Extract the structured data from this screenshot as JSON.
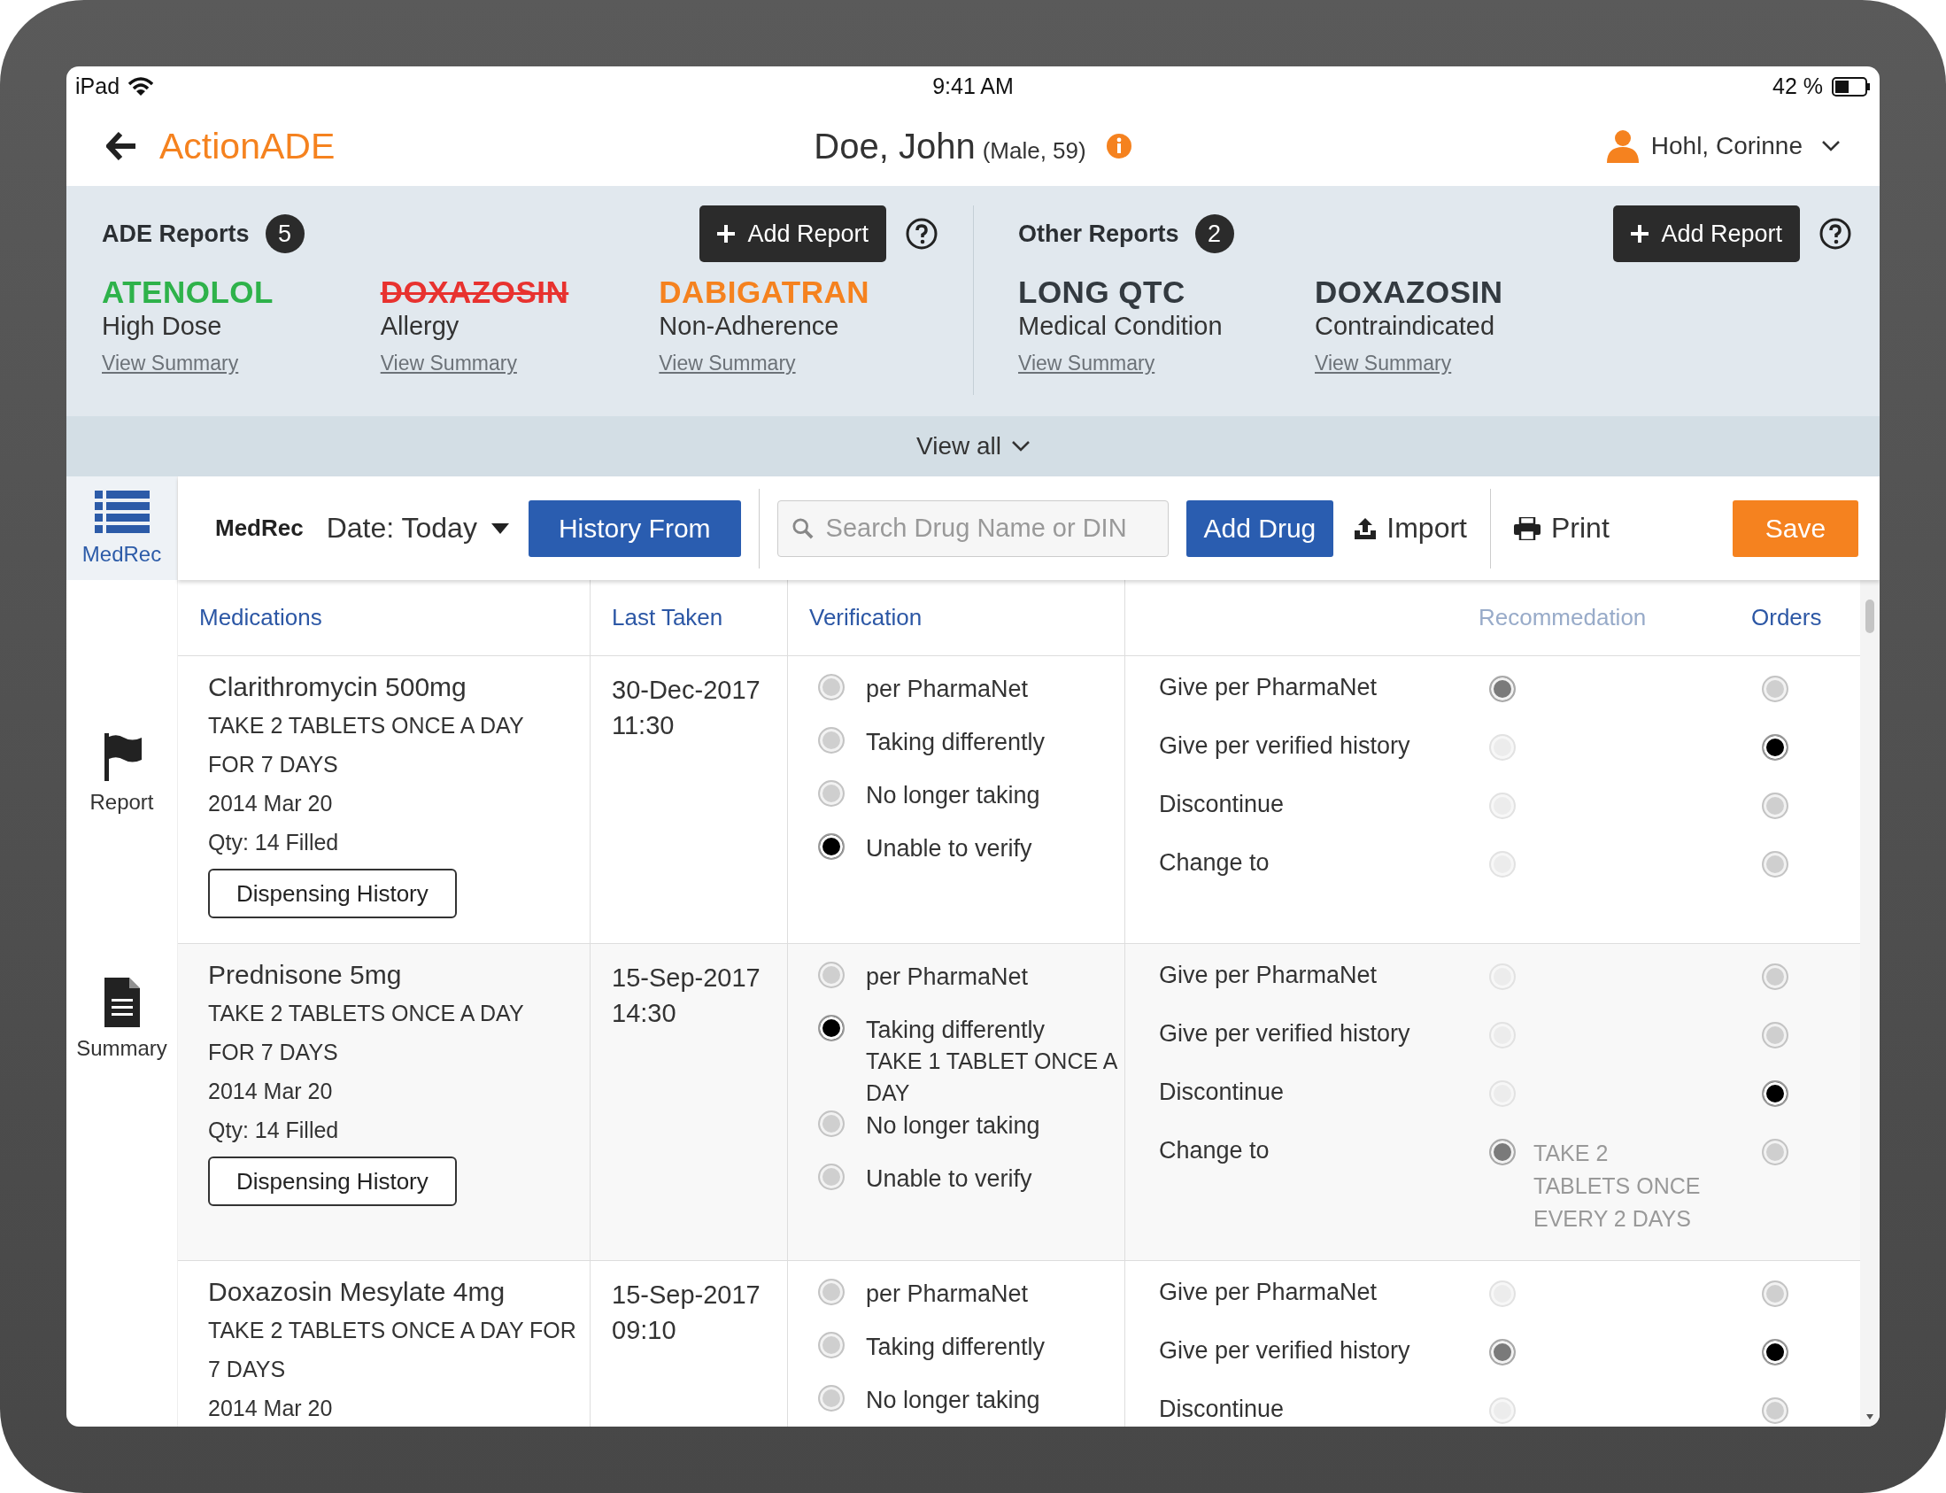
{
  "status_bar": {
    "device": "iPad",
    "time": "9:41 AM",
    "battery": "42 %"
  },
  "header": {
    "app_name": "ActionADE",
    "patient_name": "Doe, John",
    "patient_info": "(Male, 59)",
    "user": "Hohl, Corinne"
  },
  "ade_reports": {
    "title": "ADE Reports",
    "count": "5",
    "add_button": "Add Report",
    "items": [
      {
        "drug": "ATENOLOL",
        "reason": "High Dose",
        "link": "View Summary",
        "color": "#2eb24a",
        "struck": false
      },
      {
        "drug": "DOXAZOSIN",
        "reason": "Allergy",
        "link": "View Summary",
        "color": "#e8322f",
        "struck": true
      },
      {
        "drug": "DABIGATRAN",
        "reason": "Non-Adherence",
        "link": "View Summary",
        "color": "#f5821f",
        "struck": false
      }
    ]
  },
  "other_reports": {
    "title": "Other Reports",
    "count": "2",
    "add_button": "Add Report",
    "items": [
      {
        "drug": "LONG QTC",
        "reason": "Medical Condition",
        "link": "View Summary",
        "color": "#333a40",
        "struck": false
      },
      {
        "drug": "DOXAZOSIN",
        "reason": "Contraindicated",
        "link": "View Summary",
        "color": "#333a40",
        "struck": false
      }
    ]
  },
  "view_all": "View all",
  "sidebar": [
    {
      "label": "MedRec",
      "kind": "list",
      "selected": true
    },
    {
      "label": "Report",
      "kind": "flag",
      "selected": false
    },
    {
      "label": "Summary",
      "kind": "document",
      "selected": false
    }
  ],
  "toolbar": {
    "title": "MedRec",
    "date": "Date: Today",
    "history_button": "History From",
    "search": {
      "placeholder": "Search Drug Name or DIN"
    },
    "add_drug": "Add Drug",
    "import": "Import",
    "print": "Print",
    "save": "Save"
  },
  "table": {
    "columns": [
      {
        "label": "Medications",
        "disabled": false
      },
      {
        "label": "Last Taken",
        "disabled": false
      },
      {
        "label": "Verification",
        "disabled": false
      },
      {
        "label": "Recommedation",
        "disabled": true
      },
      {
        "label": "Orders",
        "disabled": false
      }
    ],
    "rows": [
      {
        "name": "Clarithromycin 500mg",
        "details": [
          "TAKE 2 TABLETS ONCE A DAY",
          "FOR 7 DAYS",
          "2014 Mar 20",
          "Qty: 14 Filled"
        ],
        "history_button": "Dispensing History",
        "last_taken": {
          "date": "30-Dec-2017",
          "time": "11:30"
        },
        "verification": [
          {
            "label": "per PharmaNet",
            "selected": false
          },
          {
            "label": "Taking differently",
            "selected": false
          },
          {
            "label": "No longer taking",
            "selected": false
          },
          {
            "label": "Unable to verify",
            "selected": true
          }
        ],
        "options": [
          {
            "label": "Give per PharmaNet",
            "recommended": true,
            "ordered": false
          },
          {
            "label": "Give per verified history",
            "recommended": false,
            "ordered": true
          },
          {
            "label": "Discontinue",
            "recommended": false,
            "ordered": false
          },
          {
            "label": "Change to",
            "recommended": false,
            "ordered": false
          }
        ]
      },
      {
        "name": "Prednisone 5mg",
        "details": [
          "TAKE 2 TABLETS ONCE A DAY",
          "FOR 7 DAYS",
          "2014 Mar 20",
          "Qty: 14 Filled"
        ],
        "history_button": "Dispensing History",
        "last_taken": {
          "date": "15-Sep-2017",
          "time": "14:30"
        },
        "verification": [
          {
            "label": "per PharmaNet",
            "selected": false
          },
          {
            "label": "Taking differently",
            "selected": true,
            "note": "TAKE 1 TABLET ONCE A DAY"
          },
          {
            "label": "No longer taking",
            "selected": false
          },
          {
            "label": "Unable to verify",
            "selected": false
          }
        ],
        "options": [
          {
            "label": "Give per PharmaNet",
            "recommended": false,
            "ordered": false
          },
          {
            "label": "Give per verified history",
            "recommended": false,
            "ordered": false
          },
          {
            "label": "Discontinue",
            "recommended": false,
            "ordered": true
          },
          {
            "label": "Change to",
            "recommended": true,
            "ordered": false,
            "note": "TAKE 2 TABLETS ONCE EVERY 2 DAYS"
          }
        ]
      },
      {
        "name": "Doxazosin Mesylate 4mg",
        "details": [
          "TAKE 2 TABLETS ONCE A DAY FOR 7 DAYS",
          "2014 Mar 20"
        ],
        "last_taken": {
          "date": "15-Sep-2017",
          "time": "09:10"
        },
        "verification": [
          {
            "label": "per PharmaNet",
            "selected": false
          },
          {
            "label": "Taking differently",
            "selected": false
          },
          {
            "label": "No longer taking",
            "selected": false
          }
        ],
        "options": [
          {
            "label": "Give per PharmaNet",
            "recommended": false,
            "ordered": false
          },
          {
            "label": "Give per verified history",
            "recommended": true,
            "ordered": true
          },
          {
            "label": "Discontinue",
            "recommended": false,
            "ordered": false
          }
        ]
      }
    ]
  }
}
